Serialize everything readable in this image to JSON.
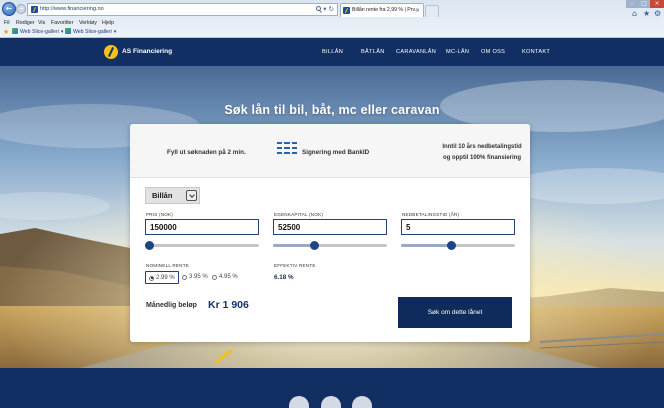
{
  "browser": {
    "url": "http://www.financiering.no",
    "tab_title": "Billån rente fra 2,99 % | Prv...",
    "menu": [
      "Fil",
      "Rediger",
      "Vis",
      "Favoritter",
      "Verktøy",
      "Hjelp"
    ],
    "favorites": [
      "Web Slice-galleri",
      "Web Slice-galleri"
    ]
  },
  "header": {
    "logo_text": "AS Financiering",
    "nav": [
      "BILLÅN",
      "BÅTLÅN",
      "CARAVANLÅN",
      "MC-LÅN",
      "OM OSS",
      "KONTAKT"
    ]
  },
  "hero": {
    "title": "Søk lån til bil, båt, mc eller caravan",
    "features": [
      {
        "text": "Fyll ut søknaden på 2 min."
      },
      {
        "text": "Signering med BankID",
        "icon": "bankid-icon"
      },
      {
        "line1": "Inntil 10 års nedbetalingstid",
        "line2": "og opptil 100% finansiering"
      }
    ]
  },
  "form": {
    "loan_type": {
      "selected": "Billån"
    },
    "fields": [
      {
        "label": "PRIS (NOK)",
        "value": "150000",
        "slider_level": 0.03
      },
      {
        "label": "EGENKAPITAL (NOK)",
        "value": "52500",
        "slider_level": 0.36
      },
      {
        "label": "NEDBETALINGSTID (ÅR)",
        "value": "5",
        "slider_level": 0.44
      }
    ],
    "nominal_rate": {
      "label": "NOMINELL RENTE",
      "options": [
        "2.99 %",
        "3.95 %",
        "4.95 %"
      ],
      "selected_index": 0
    },
    "effective_rate": {
      "label": "EFFEKTIV RENTE",
      "value": "6.18 %"
    },
    "monthly": {
      "label": "Månedlig beløp",
      "value": "Kr 1 906"
    },
    "submit_label": "Søk om dette lånet"
  },
  "theme": {
    "header_bg": "#112f63",
    "accent": "#1e4488",
    "button_bg": "#0f2b5b",
    "logo_yellow": "#f5c01a",
    "close_red": "#c9483a"
  },
  "icons": [
    "back-icon",
    "forward-icon",
    "search-icon",
    "refresh-icon",
    "home-icon",
    "star-icon",
    "gear-icon",
    "bankid-icon",
    "chevron-down-icon",
    "logo-icon"
  ]
}
